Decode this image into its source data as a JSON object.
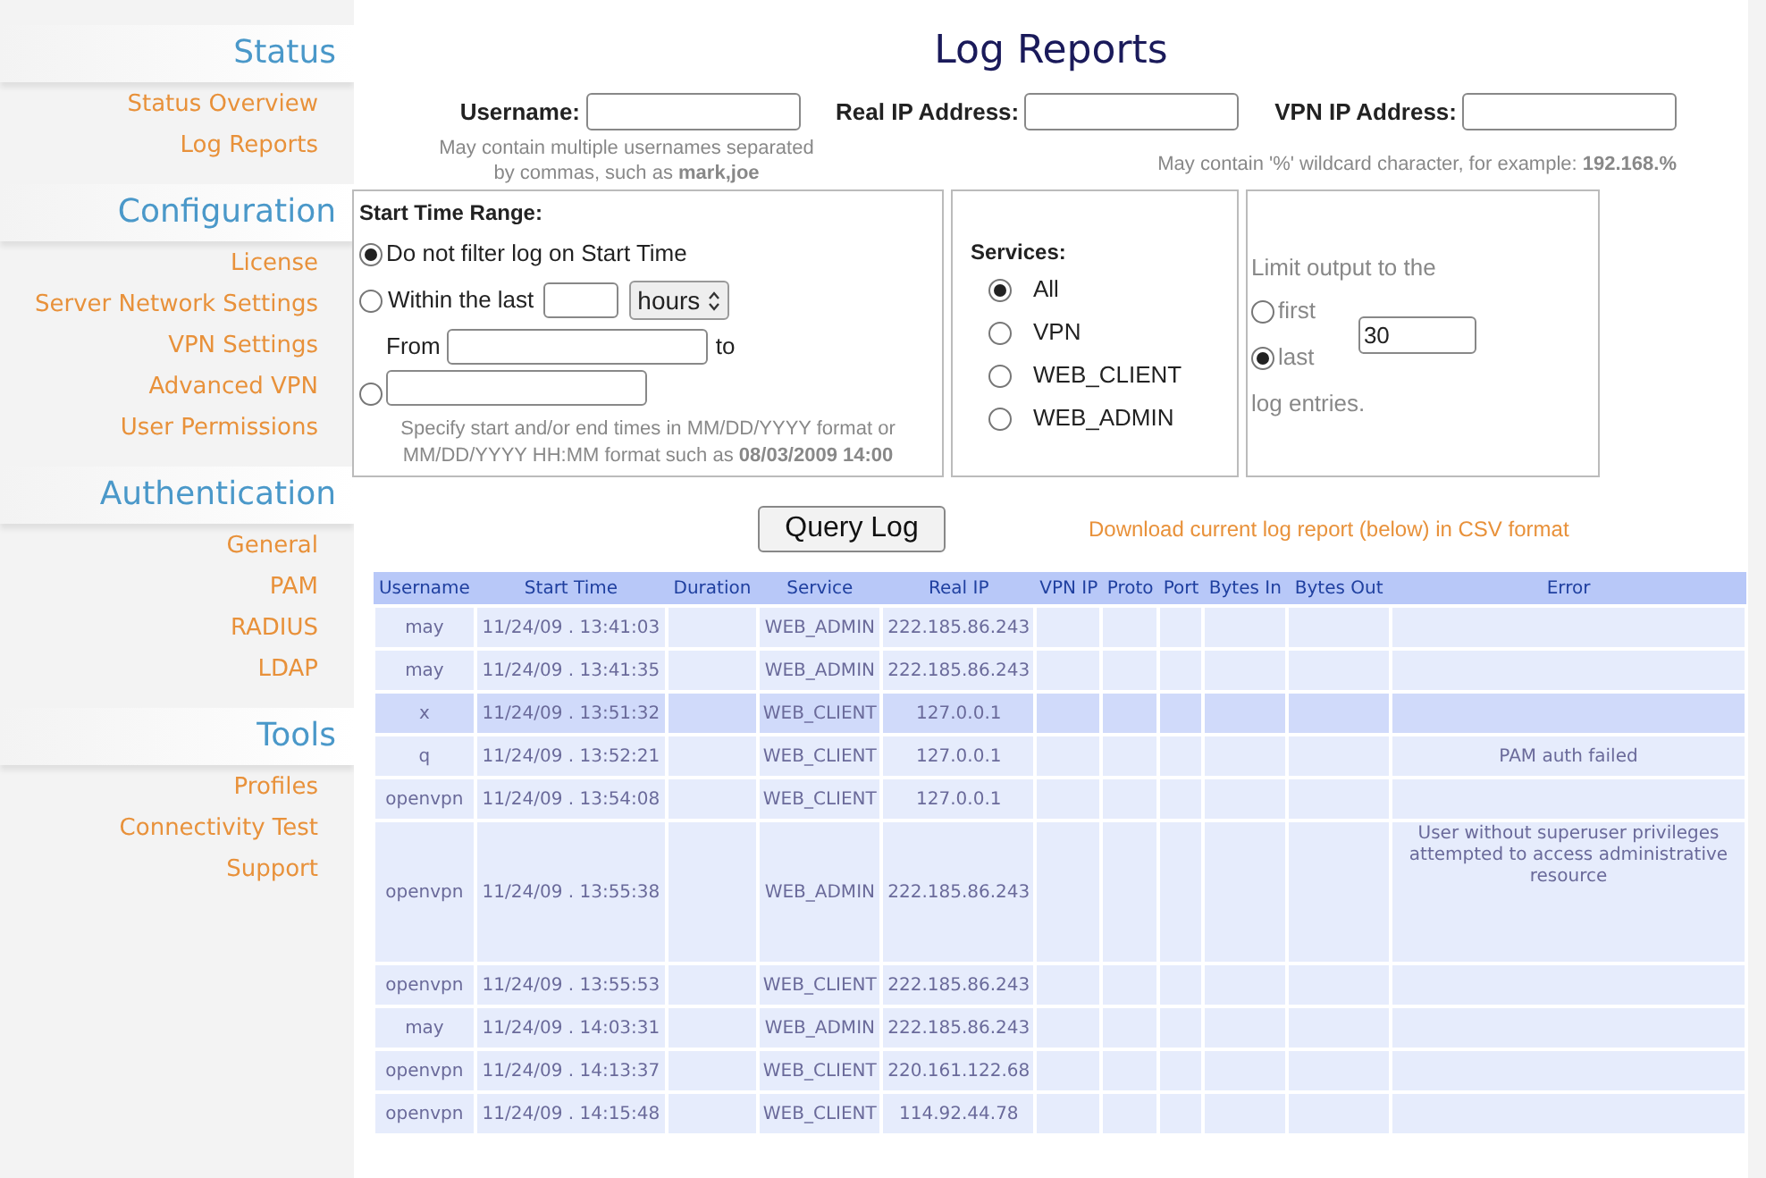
{
  "sidebar": {
    "sections": [
      {
        "title": "Status",
        "items": [
          {
            "label": "Status Overview"
          },
          {
            "label": "Log Reports"
          }
        ]
      },
      {
        "title": "Configuration",
        "items": [
          {
            "label": "License"
          },
          {
            "label": "Server Network Settings"
          },
          {
            "label": "VPN Settings"
          },
          {
            "label": "Advanced VPN"
          },
          {
            "label": "User Permissions"
          }
        ]
      },
      {
        "title": "Authentication",
        "items": [
          {
            "label": "General"
          },
          {
            "label": "PAM"
          },
          {
            "label": "RADIUS"
          },
          {
            "label": "LDAP"
          }
        ]
      },
      {
        "title": "Tools",
        "items": [
          {
            "label": "Profiles"
          },
          {
            "label": "Connectivity Test"
          },
          {
            "label": "Support"
          }
        ]
      }
    ]
  },
  "page_title": "Log Reports",
  "fields": [
    {
      "label": "Username:"
    },
    {
      "label": "Real IP Address:"
    },
    {
      "label": "VPN IP Address:"
    }
  ],
  "username_hint": "May contain multiple usernames separated by commas, such as **mark,joe**",
  "ip_hint": "May contain '%' wildcard character, for example: **192.168.%**",
  "start_time": {
    "title": "Start Time Range:",
    "options": [
      {
        "kind": "plain",
        "label": "Do not filter log on Start Time",
        "selected": true
      },
      {
        "kind": "within",
        "label": "Within the last",
        "unit": "hours",
        "selected": false
      },
      {
        "kind": "range",
        "label": "From",
        "to_label": "to",
        "selected": false
      }
    ],
    "hint": "Specify start and/or end times in MM/DD/YYYY format or MM/DD/YYYY HH:MM format such as **08/03/2009 14:00**"
  },
  "services": {
    "title": "Services:",
    "options": [
      {
        "label": "All",
        "selected": true
      },
      {
        "label": "VPN",
        "selected": false
      },
      {
        "label": "WEB_CLIENT",
        "selected": false
      },
      {
        "label": "WEB_ADMIN",
        "selected": false
      }
    ]
  },
  "limit": {
    "intro": "Limit output to the",
    "options": [
      {
        "label": "first",
        "selected": false
      },
      {
        "label": "last",
        "selected": true
      }
    ],
    "value": "30",
    "outro": "log entries."
  },
  "query_button": "Query Log",
  "download_link": "Download current log report (below) in CSV format",
  "table": {
    "columns": [
      "Username",
      "Start Time",
      "Duration",
      "Service",
      "Real IP",
      "VPN IP",
      "Proto",
      "Port",
      "Bytes In",
      "Bytes Out",
      "Error"
    ],
    "rows": [
      {
        "username": "may",
        "start_time": "11/24/09 . 13:41:03",
        "service": "WEB_ADMIN",
        "real_ip": "222.185.86.243",
        "highlighted": false
      },
      {
        "username": "may",
        "start_time": "11/24/09 . 13:41:35",
        "service": "WEB_ADMIN",
        "real_ip": "222.185.86.243",
        "highlighted": false
      },
      {
        "username": "x",
        "start_time": "11/24/09 . 13:51:32",
        "service": "WEB_CLIENT",
        "real_ip": "127.0.0.1",
        "highlighted": true
      },
      {
        "username": "q",
        "start_time": "11/24/09 . 13:52:21",
        "service": "WEB_CLIENT",
        "real_ip": "127.0.0.1",
        "error": "PAM auth failed",
        "highlighted": false
      },
      {
        "username": "openvpn",
        "start_time": "11/24/09 . 13:54:08",
        "service": "WEB_CLIENT",
        "real_ip": "127.0.0.1",
        "highlighted": false
      },
      {
        "username": "openvpn",
        "start_time": "11/24/09 . 13:55:38",
        "service": "WEB_ADMIN",
        "real_ip": "222.185.86.243",
        "error": "User without superuser privileges attempted to access administrative resource",
        "highlighted": false
      },
      {
        "username": "openvpn",
        "start_time": "11/24/09 . 13:55:53",
        "service": "WEB_CLIENT",
        "real_ip": "222.185.86.243",
        "highlighted": false
      },
      {
        "username": "may",
        "start_time": "11/24/09 . 14:03:31",
        "service": "WEB_ADMIN",
        "real_ip": "222.185.86.243",
        "highlighted": false
      },
      {
        "username": "openvpn",
        "start_time": "11/24/09 . 14:13:37",
        "service": "WEB_CLIENT",
        "real_ip": "220.161.122.68",
        "highlighted": false
      },
      {
        "username": "openvpn",
        "start_time": "11/24/09 . 14:15:48",
        "service": "WEB_CLIENT",
        "real_ip": "114.92.44.78",
        "highlighted": false
      }
    ]
  }
}
